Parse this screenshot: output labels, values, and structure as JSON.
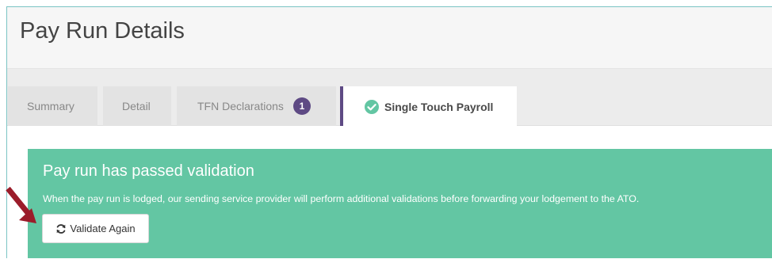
{
  "header": {
    "title": "Pay Run Details"
  },
  "tabs": {
    "summary": "Summary",
    "detail": "Detail",
    "tfn": "TFN Declarations",
    "tfn_badge": "1",
    "stp": "Single Touch Payroll",
    "active": "stp"
  },
  "alert": {
    "title": "Pay run has passed validation",
    "message": "When the pay run is lodged, our sending service provider will perform additional validations before forwarding your lodgement to the ATO.",
    "button_label": "Validate Again"
  },
  "icons": {
    "stp_status": "check-circle-icon",
    "validate": "refresh-icon",
    "annotation": "arrow-icon"
  },
  "colors": {
    "alert_background": "#63c6a3",
    "accent_purple": "#5e4a84",
    "annotation_arrow": "#9b1c2a"
  }
}
